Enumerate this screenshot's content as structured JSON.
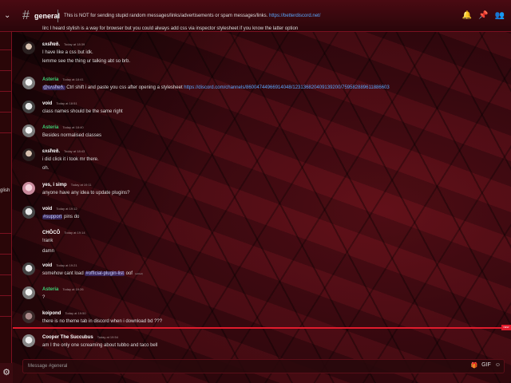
{
  "channel": {
    "name": "general",
    "topic": "This is NOT for sending stupid random messages/links/advertisements or spam messages/links.",
    "topic_link": "https://betterdiscord.net/"
  },
  "header_icons": [
    "bell-icon",
    "pin-icon",
    "members-icon"
  ],
  "sidebar": {
    "fragment_label": "glish"
  },
  "messages": [
    {
      "name": "",
      "time": "",
      "lines": [
        "Iirc I heard stylish is a way for browser but you could always add css via inspector stylesheet if you know the latter option"
      ]
    },
    {
      "name": "ɛʌsħɐð.",
      "time": "Today at 18:39",
      "lines": [
        "I have like a css but idk.",
        "lemme see the thing ur talking abt so brb."
      ]
    },
    {
      "name": "Asteria",
      "time": "Today at 18:41",
      "mention": "@ɛʌsħɐð.",
      "text": " Ctrl shift i and paste you css after opening a stylesheet ",
      "link": "https://discord.com/channels/86004744966914048/123136820409139200/759582889611886603"
    },
    {
      "name": "void",
      "time": "Today at 18:51",
      "lines": [
        "class names should be the same right"
      ]
    },
    {
      "name": "Asteria",
      "time": "Today at 18:40",
      "lines": [
        "Besides normalised classes"
      ]
    },
    {
      "name": "ɛʌsħɐð.",
      "time": "Today at 18:43",
      "lines": [
        "i did click it i took mr there.",
        "oh."
      ]
    },
    {
      "name": "yes, i simp",
      "time": "Today at 19:11",
      "lines": [
        "anyone have any idea to update plugins?"
      ]
    },
    {
      "name": "void",
      "time": "Today at 19:12",
      "mention": "#support",
      "text": " pins do"
    },
    {
      "name": "CHÔCÔ",
      "time": "Today at 19:14",
      "lines": [
        "!rank",
        "damn"
      ]
    },
    {
      "name": "void",
      "time": "Today at 19:21",
      "text": "somehow cant load ",
      "mention": "#official-plugin-list",
      "text2": " oof",
      "edited": "(edited)"
    },
    {
      "name": "Asteria",
      "time": "Today at 19:26",
      "lines": [
        "?"
      ]
    },
    {
      "name": "koipond",
      "time": "Today at 19:50",
      "lines": [
        "there is no theme tab in discord when i download bd ???"
      ]
    },
    {
      "name": "Cooper The Succubus",
      "time": "Today at 19:54",
      "lines": [
        "am I the only one screaming about tubbo and taco bell"
      ]
    }
  ],
  "new_label": "NEW",
  "input": {
    "placeholder": "Message #general"
  },
  "input_icons": [
    "gift-icon",
    "gif-icon",
    "emoji-icon"
  ],
  "colors": {
    "asteria": "#3fcf75",
    "default_name": "#ffffff",
    "link": "#5aa8ff",
    "accent": "#e01b2c"
  }
}
